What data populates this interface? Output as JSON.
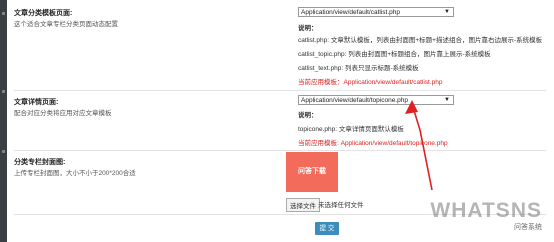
{
  "section1": {
    "label": "文章分类模板页面:",
    "desc": "这个适合文章专栏分类页面动态配置",
    "select_value": "Application/view/default/catlist.php",
    "notes_title": "说明：",
    "notes": [
      "catlist.php: 文章默认模板，列表由封面图+标题+描述组合，图片靠右边展示-系统模板",
      "catlist_topic.php: 列表由封面图+标题组合，图片靠上展示-系统模板",
      "catlist_text.php: 列表只显示标题-系统模板"
    ],
    "current_label": "当前应用模板：Application/view/default/catlist.php"
  },
  "section2": {
    "label": "文章详情页面:",
    "desc": "配合对应分类将应用对应文章模板",
    "select_value": "Application/view/default/topicone.php",
    "notes_title": "说明：",
    "notes": [
      "topicone.php: 文章详情页面默认模板"
    ],
    "current_label": "当前应用模板: Application/view/default/topicone.php"
  },
  "section3": {
    "label": "分类专栏封面图:",
    "desc": "上传专栏封面图，大小不小于200*200合适",
    "thumb_text": "问答下载",
    "file_button": "选择文件",
    "file_status": "未选择任何文件"
  },
  "submit_label": "提 交",
  "watermark": {
    "big": "WHATSNS",
    "small": "问答系统"
  },
  "colors": {
    "accent": "#e02020",
    "button": "#3c8dbc",
    "thumb": "#f26b5b"
  }
}
